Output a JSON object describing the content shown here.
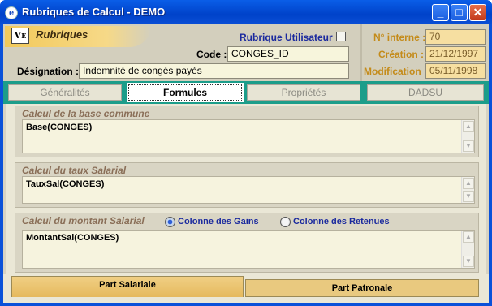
{
  "window": {
    "title": "Rubriques de Calcul - DEMO"
  },
  "logo": {
    "text": "Rubriques"
  },
  "header": {
    "rubrique_utilisateur_label": "Rubrique Utilisateur",
    "code_label": "Code :",
    "code_value": "CONGES_ID",
    "designation_label": "Désignation :",
    "designation_value": "Indemnité de congés payés",
    "numero_interne_label": "N° interne :",
    "numero_interne_value": "70",
    "creation_label": "Création :",
    "creation_value": "21/12/1997",
    "modification_label": "Modification :",
    "modification_value": "05/11/1998"
  },
  "tabs": [
    {
      "label": "Généralités",
      "active": false
    },
    {
      "label": "Formules",
      "active": true
    },
    {
      "label": "Propriétés",
      "active": false
    },
    {
      "label": "DADSU",
      "active": false
    }
  ],
  "sections": [
    {
      "title": "Calcul de la base commune",
      "value": "Base(CONGES)"
    },
    {
      "title": "Calcul du taux Salarial",
      "value": "TauxSal(CONGES)"
    },
    {
      "title": "Calcul du montant Salarial",
      "value": "MontantSal(CONGES)"
    }
  ],
  "montant_options": {
    "gains_label": "Colonne des Gains",
    "retenues_label": "Colonne des Retenues",
    "selected": "gains"
  },
  "bottom_tabs": [
    {
      "label": "Part Salariale",
      "active": true
    },
    {
      "label": "Part Patronale",
      "active": false
    }
  ],
  "colors": {
    "title_bar": "#0a51d9",
    "accent_teal": "#1c9d8a",
    "label_blue": "#1b2a9e",
    "label_orange": "#c48b1a"
  }
}
